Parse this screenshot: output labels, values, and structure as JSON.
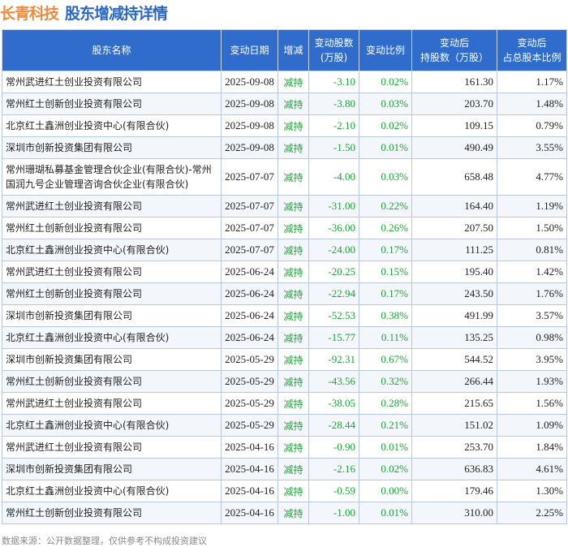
{
  "header": {
    "company": "长青科技",
    "title": "股东增减持详情"
  },
  "columns": [
    "股东名称",
    "变动日期",
    "增减",
    "变动股数\n(万股)",
    "变动比例",
    "变动后\n持股数（万股）",
    "变动后\n占总股本比例"
  ],
  "rows": [
    [
      "常州武进红土创业投资有限公司",
      "2025-09-08",
      "减持",
      "-3.10",
      "0.02%",
      "161.30",
      "1.17%"
    ],
    [
      "常州红土创新创业投资有限公司",
      "2025-09-08",
      "减持",
      "-3.80",
      "0.03%",
      "203.70",
      "1.48%"
    ],
    [
      "北京红土鑫洲创业投资中心(有限合伙)",
      "2025-09-08",
      "减持",
      "-2.10",
      "0.02%",
      "109.15",
      "0.79%"
    ],
    [
      "深圳市创新投资集团有限公司",
      "2025-09-08",
      "减持",
      "-1.50",
      "0.01%",
      "490.49",
      "3.55%"
    ],
    [
      "常州珊瑚私募基金管理合伙企业(有限合伙)-常州国润九号企业管理咨询合伙企业(有限合伙)",
      "2025-07-07",
      "减持",
      "-4.00",
      "0.03%",
      "658.48",
      "4.77%"
    ],
    [
      "常州武进红土创业投资有限公司",
      "2025-07-07",
      "减持",
      "-31.00",
      "0.22%",
      "164.40",
      "1.19%"
    ],
    [
      "常州红土创新创业投资有限公司",
      "2025-07-07",
      "减持",
      "-36.00",
      "0.26%",
      "207.50",
      "1.50%"
    ],
    [
      "北京红土鑫洲创业投资中心(有限合伙)",
      "2025-07-07",
      "减持",
      "-24.00",
      "0.17%",
      "111.25",
      "0.81%"
    ],
    [
      "常州武进红土创业投资有限公司",
      "2025-06-24",
      "减持",
      "-20.25",
      "0.15%",
      "195.40",
      "1.42%"
    ],
    [
      "常州红土创新创业投资有限公司",
      "2025-06-24",
      "减持",
      "-22.94",
      "0.17%",
      "243.50",
      "1.76%"
    ],
    [
      "深圳市创新投资集团有限公司",
      "2025-06-24",
      "减持",
      "-52.53",
      "0.38%",
      "491.99",
      "3.57%"
    ],
    [
      "北京红土鑫洲创业投资中心(有限合伙)",
      "2025-06-24",
      "减持",
      "-15.77",
      "0.11%",
      "135.25",
      "0.98%"
    ],
    [
      "深圳市创新投资集团有限公司",
      "2025-05-29",
      "减持",
      "-92.31",
      "0.67%",
      "544.52",
      "3.95%"
    ],
    [
      "常州红土创新创业投资有限公司",
      "2025-05-29",
      "减持",
      "-43.56",
      "0.32%",
      "266.44",
      "1.93%"
    ],
    [
      "常州武进红土创业投资有限公司",
      "2025-05-29",
      "减持",
      "-38.05",
      "0.28%",
      "215.65",
      "1.56%"
    ],
    [
      "北京红土鑫洲创业投资中心(有限合伙)",
      "2025-05-29",
      "减持",
      "-28.44",
      "0.21%",
      "151.02",
      "1.09%"
    ],
    [
      "常州武进红土创业投资有限公司",
      "2025-04-16",
      "减持",
      "-0.90",
      "0.01%",
      "253.70",
      "1.84%"
    ],
    [
      "深圳市创新投资集团有限公司",
      "2025-04-16",
      "减持",
      "-2.16",
      "0.02%",
      "636.83",
      "4.61%"
    ],
    [
      "北京红土鑫洲创业投资中心(有限合伙)",
      "2025-04-16",
      "减持",
      "-0.59",
      "0.00%",
      "179.46",
      "1.30%"
    ],
    [
      "常州红土创新创业投资有限公司",
      "2025-04-16",
      "减持",
      "-1.00",
      "0.01%",
      "310.00",
      "2.25%"
    ]
  ],
  "footer": "数据来源：公开数据整理，仅供参考不构成投资建议"
}
